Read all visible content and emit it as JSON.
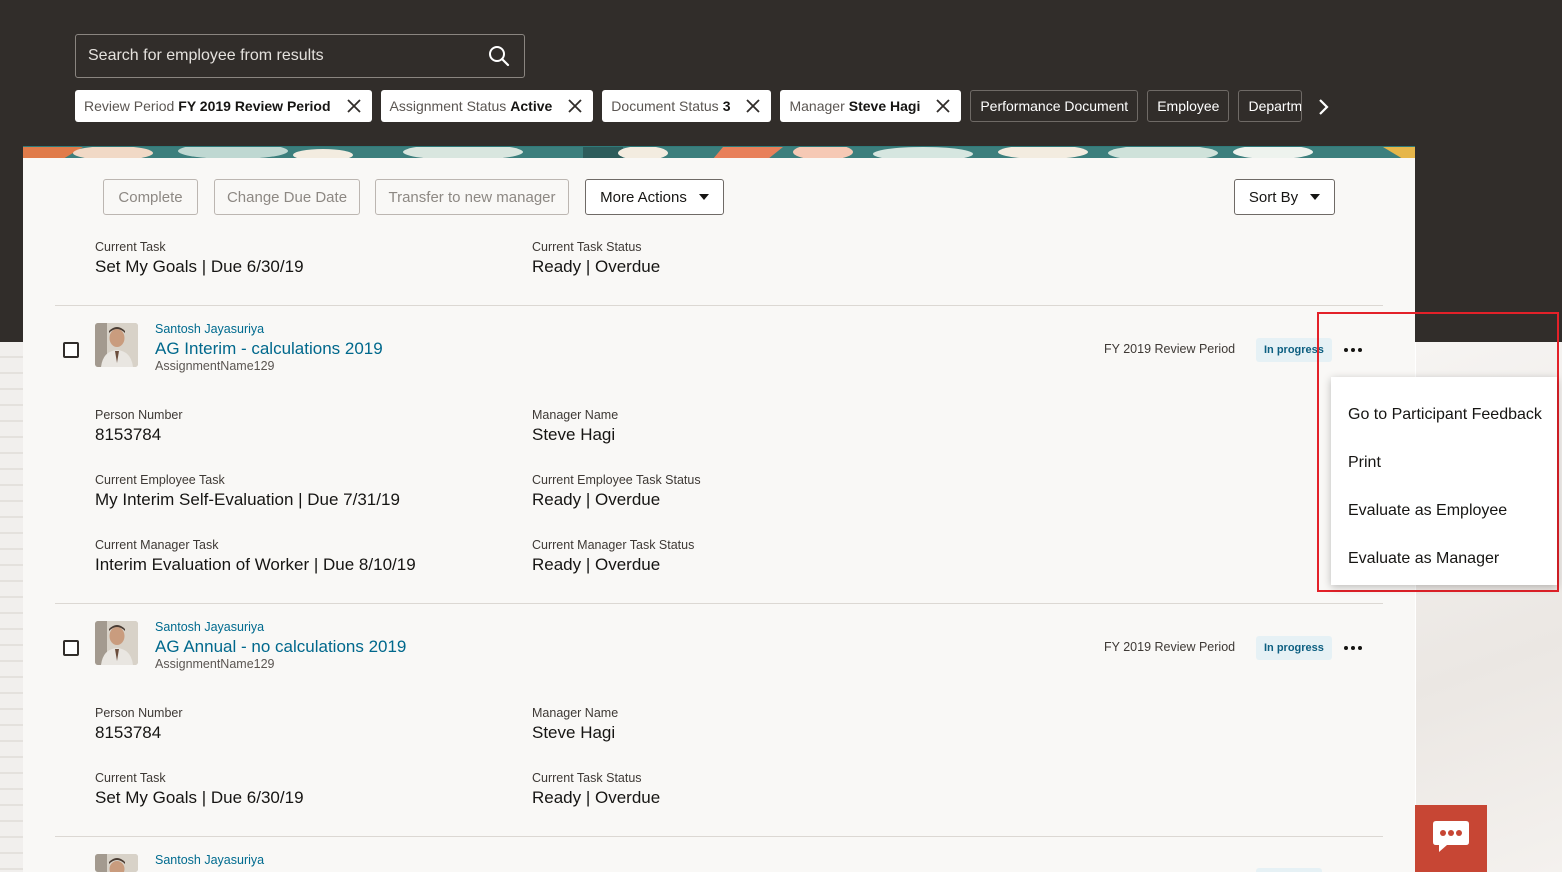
{
  "search": {
    "placeholder": "Search for employee from results"
  },
  "chips": [
    {
      "label": "Review Period",
      "value": "FY 2019 Review Period"
    },
    {
      "label": "Assignment Status",
      "value": "Active"
    },
    {
      "label": "Document Status",
      "value": "3"
    },
    {
      "label": "Manager",
      "value": "Steve Hagi"
    }
  ],
  "filter_chips": [
    "Performance Document",
    "Employee",
    "Department"
  ],
  "toolbar": {
    "complete": "Complete",
    "change_due_date": "Change Due Date",
    "transfer": "Transfer to new manager",
    "more_actions": "More Actions",
    "sort_by": "Sort By"
  },
  "top_partial": {
    "current_task_label": "Current Task",
    "current_task_value": "Set My Goals | Due 6/30/19",
    "current_task_status_label": "Current Task Status",
    "current_task_status_value": "Ready | Overdue"
  },
  "cards": [
    {
      "person": "Santosh Jayasuriya",
      "title": "AG Interim - calculations 2019",
      "assignment": "AssignmentName129",
      "period": "FY 2019 Review Period",
      "status": "In progress",
      "person_number_label": "Person Number",
      "person_number": "8153784",
      "manager_name_label": "Manager Name",
      "manager_name": "Steve Hagi",
      "employee_task_label": "Current Employee Task",
      "employee_task": "My Interim Self-Evaluation | Due 7/31/19",
      "employee_task_status_label": "Current Employee Task Status",
      "employee_task_status": "Ready | Overdue",
      "manager_task_label": "Current Manager Task",
      "manager_task": "Interim Evaluation of Worker | Due 8/10/19",
      "manager_task_status_label": "Current Manager Task Status",
      "manager_task_status": "Ready | Overdue"
    },
    {
      "person": "Santosh Jayasuriya",
      "title": "AG Annual - no calculations 2019",
      "assignment": "AssignmentName129",
      "period": "FY 2019 Review Period",
      "status": "In progress",
      "person_number_label": "Person Number",
      "person_number": "8153784",
      "manager_name_label": "Manager Name",
      "manager_name": "Steve Hagi",
      "task_label": "Current Task",
      "task": "Set My Goals | Due 6/30/19",
      "task_status_label": "Current Task Status",
      "task_status": "Ready | Overdue"
    },
    {
      "person": "Santosh Jayasuriya"
    }
  ],
  "menu": {
    "items": [
      "Go to Participant Feedback",
      "Print",
      "Evaluate as Employee",
      "Evaluate as Manager"
    ]
  },
  "colors": {
    "header_bg": "#312d2a",
    "link": "#00688c",
    "highlight": "#e32129",
    "chat": "#c74634",
    "badge_bg": "#e6f1f5"
  },
  "icons": [
    "search-icon",
    "close-icon",
    "chevron-right-icon",
    "caret-down-icon",
    "more-icon",
    "chat-icon",
    "avatar"
  ]
}
